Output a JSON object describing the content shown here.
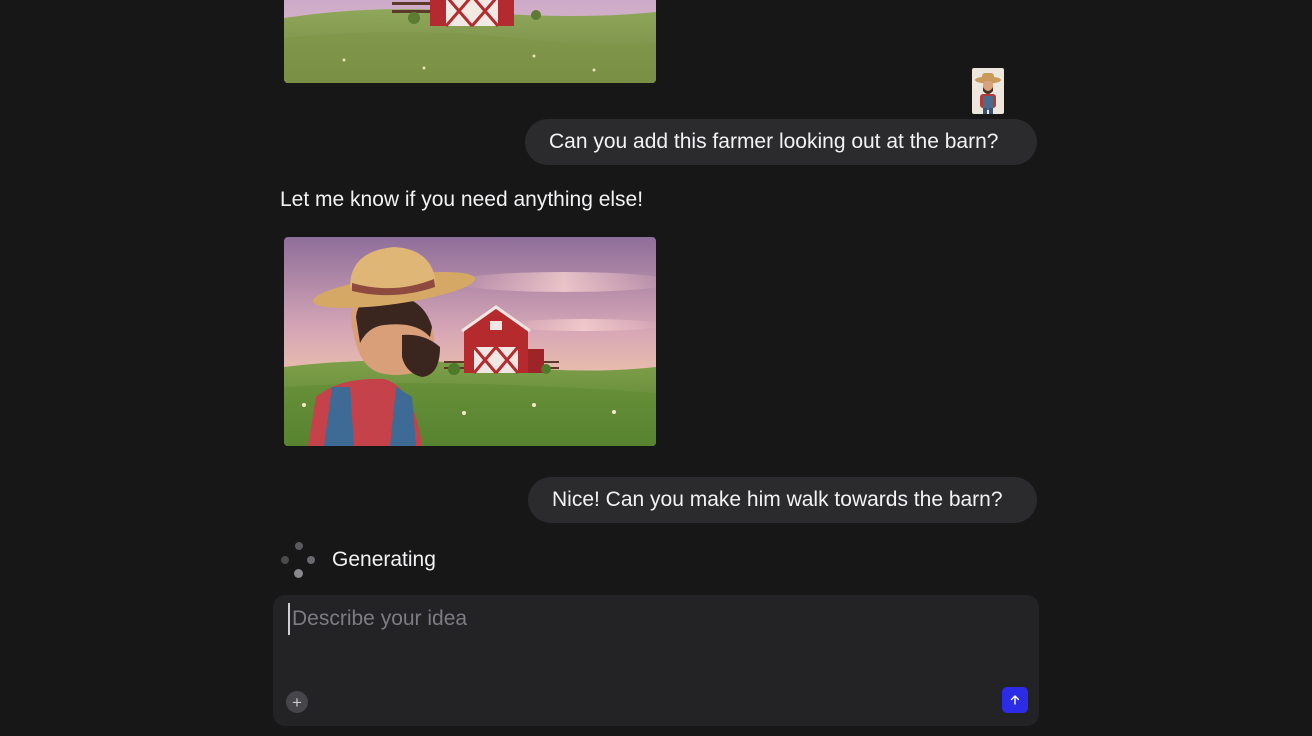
{
  "colors": {
    "background": "#171718",
    "bubble": "#2B2B2E",
    "composer": "#232326",
    "send_button": "#2B2BE8",
    "text": "#F2F2F4",
    "placeholder": "#7C7C82"
  },
  "conversation": {
    "first_image": {
      "icon": "farm-barn-image"
    },
    "reference_image": {
      "icon": "farmer-reference-thumbnail"
    },
    "user_message_1": "Can you add this farmer looking out at the barn?",
    "assistant_message": "Let me know if you need anything else!",
    "generated_image": {
      "icon": "farmer-looking-at-barn-image"
    },
    "user_message_2": "Nice! Can you make him walk towards the barn?",
    "status": {
      "icon": "loading-spinner-icon",
      "label": "Generating"
    }
  },
  "composer": {
    "placeholder": "Describe your idea",
    "value": "",
    "add_icon": "plus-icon",
    "send_icon": "arrow-up-icon"
  }
}
